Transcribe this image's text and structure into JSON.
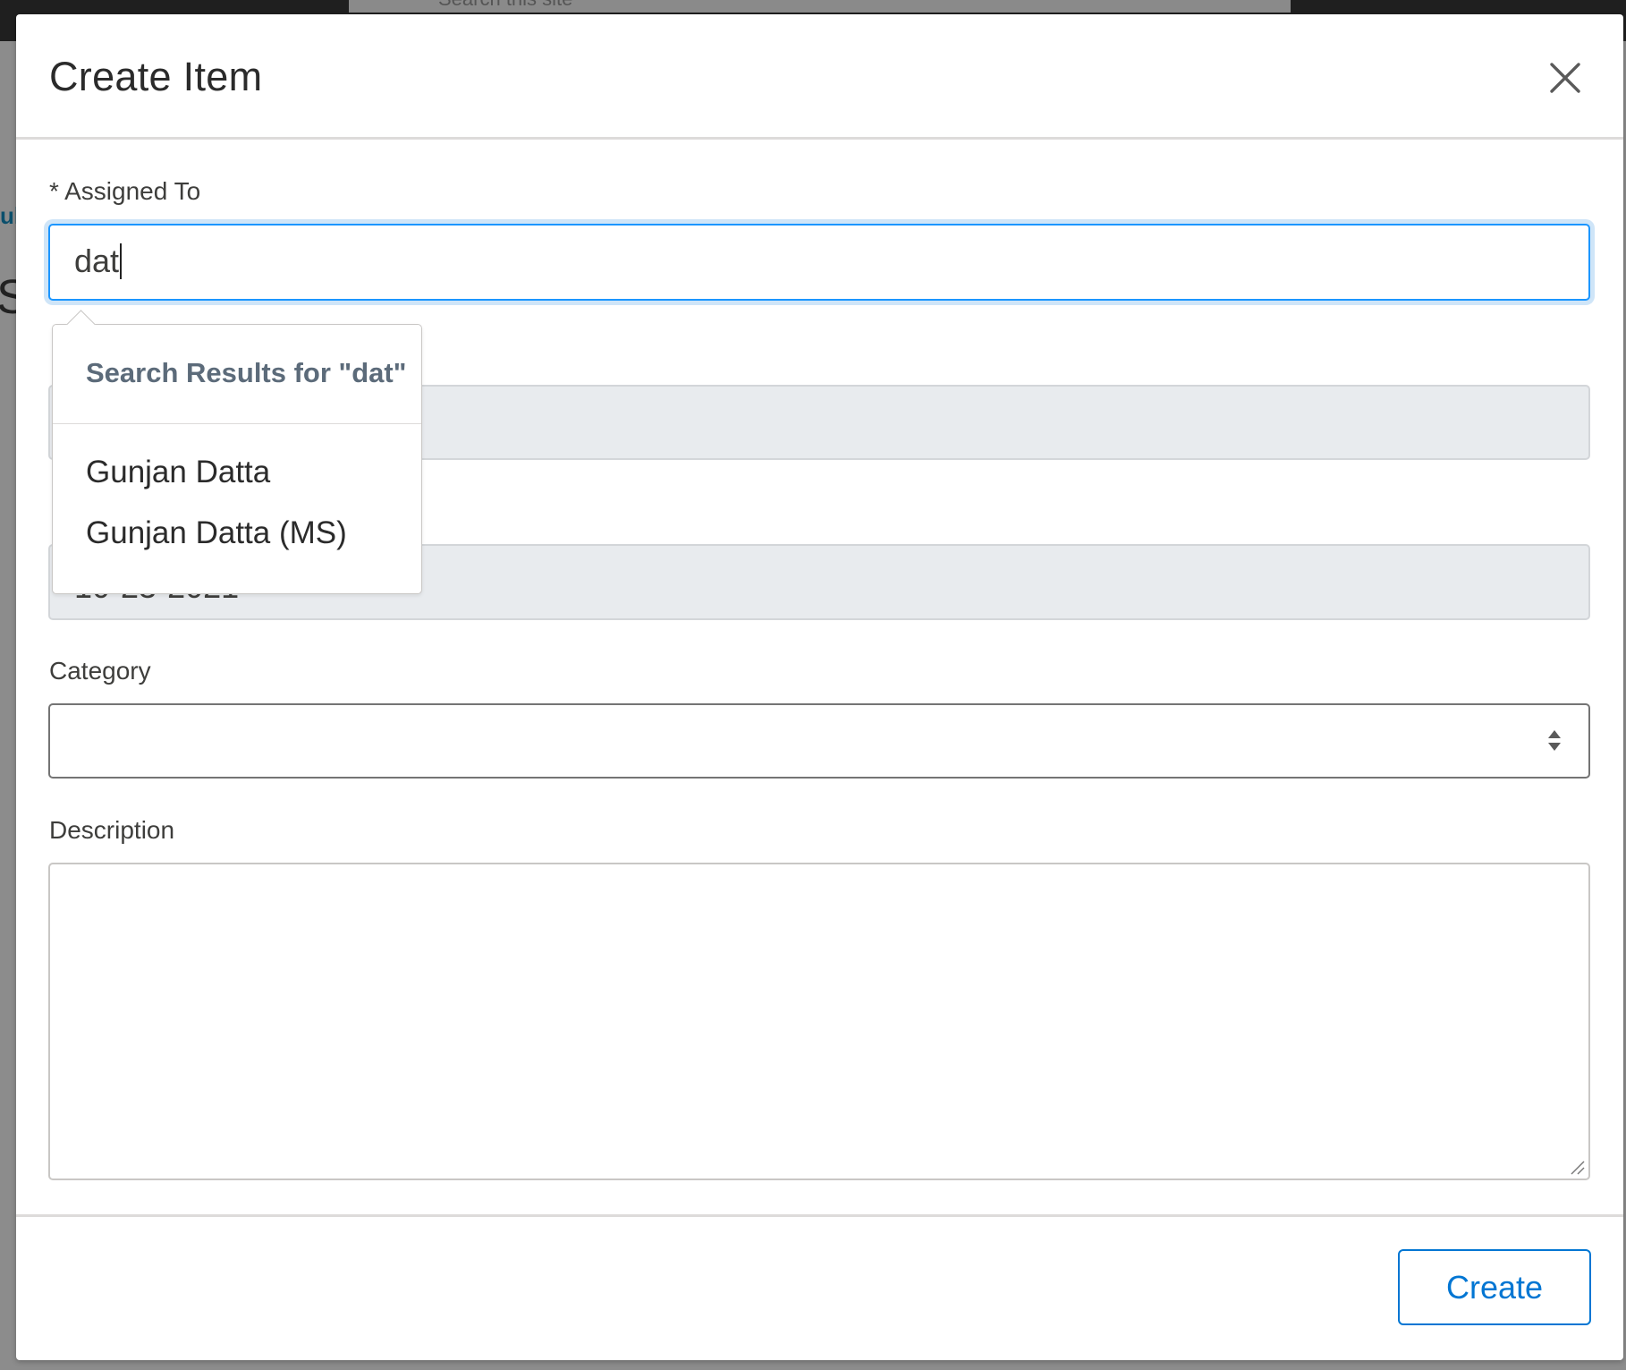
{
  "background": {
    "search_placeholder": "Search this site",
    "partial_text_1": "ul",
    "partial_text_2": "S"
  },
  "modal": {
    "title": "Create Item",
    "close_icon": "close-icon"
  },
  "form": {
    "assigned_to": {
      "label": "* Assigned To",
      "value": "dat"
    },
    "date_field": {
      "value": "10-23-2021"
    },
    "category": {
      "label": "Category",
      "value": "",
      "icon": "sort-arrows-icon"
    },
    "description": {
      "label": "Description",
      "value": ""
    }
  },
  "lookup_dropdown": {
    "header": "Search Results for \"dat\"",
    "results": [
      "Gunjan Datta",
      "Gunjan Datta (MS)"
    ]
  },
  "footer": {
    "create_label": "Create"
  },
  "colors": {
    "brand": "#0176d3",
    "focus_ring": "#1b96ff",
    "disabled_field": "#e8ebee",
    "overlay": "#7a7a7a"
  }
}
